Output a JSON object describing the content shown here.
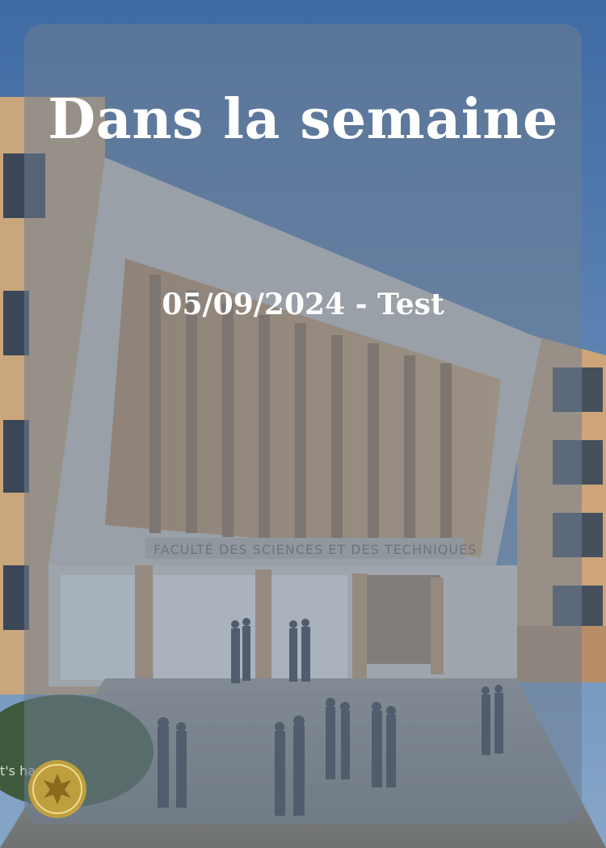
{
  "card": {
    "title": "Dans la semaine",
    "subtitle": "05/09/2024 - Test"
  },
  "background": {
    "building_sign": "FACULTÉ DES SCIENCES ET DES TECHNIQUES",
    "corner_partial_text": "t's har"
  },
  "colors": {
    "sky": "#5b7fae",
    "panel_overlay": "#6e7d91",
    "text": "#ffffff",
    "seal_gold": "#c9a43a"
  }
}
